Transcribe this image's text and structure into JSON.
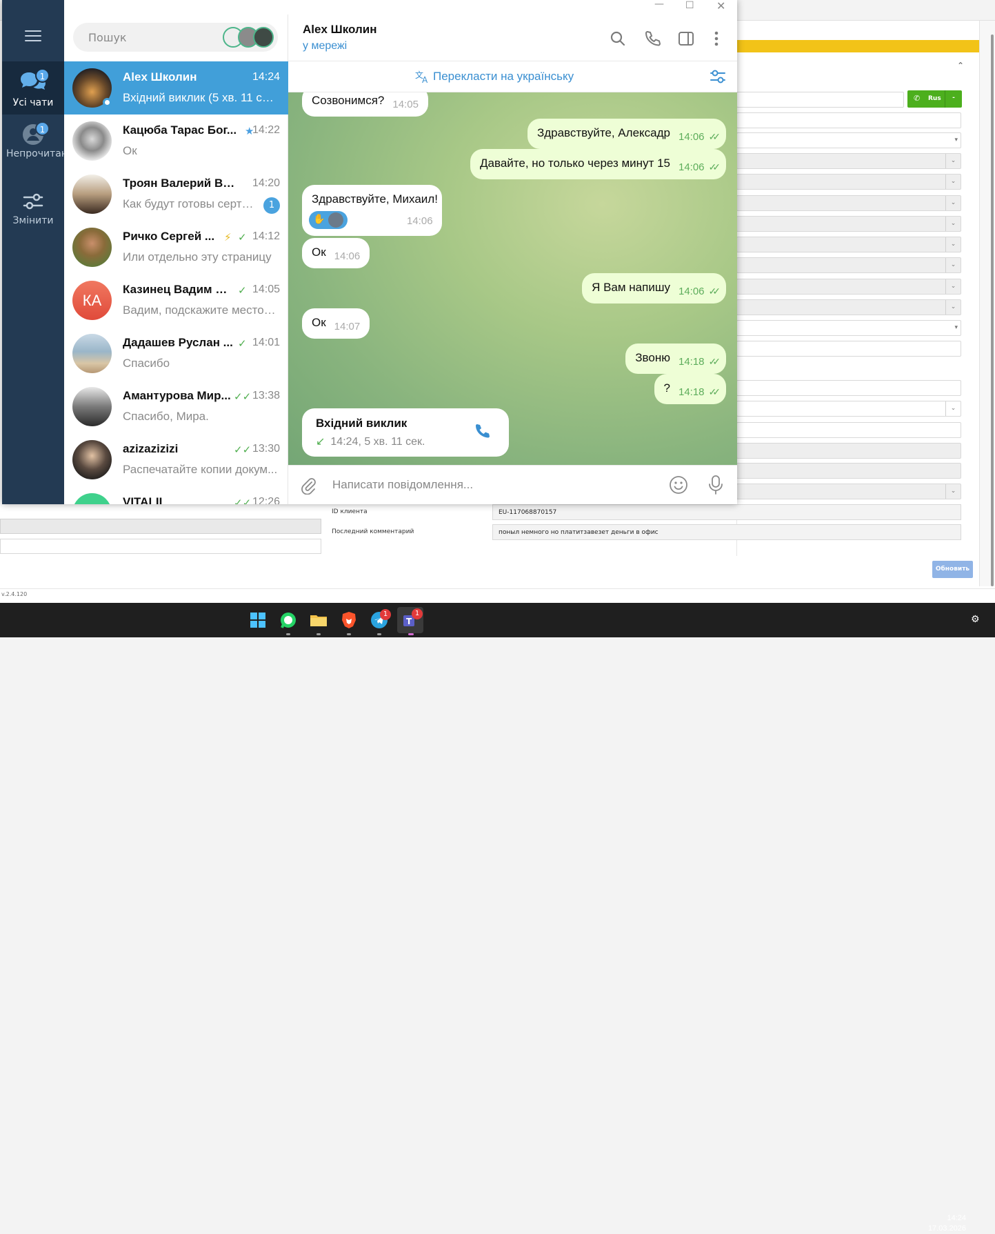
{
  "telegram": {
    "folders": [
      {
        "label": "Усі чати",
        "badge": "1"
      },
      {
        "label": "Непрочитано",
        "badge": "1"
      },
      {
        "label": "Змінити",
        "badge": ""
      }
    ],
    "search_placeholder": "Пошук",
    "chats": [
      {
        "name": "Alex Школин",
        "time": "14:24",
        "preview": "Вхідний виклик (5 хв. 11 сек.)",
        "status": "",
        "unread": ""
      },
      {
        "name": "Кацюба Тарас Бог...",
        "time": "14:22",
        "preview": "Ок",
        "status": "star",
        "unread": ""
      },
      {
        "name": "Троян Валерий Вале...",
        "time": "14:20",
        "preview": "Как будут готовы серти...",
        "status": "",
        "unread": "1"
      },
      {
        "name": "Ричко Сергей ...",
        "time": "14:12",
        "preview": "Или отдельно эту страницу",
        "status": "bolt+check",
        "unread": ""
      },
      {
        "name": "Казинец Вадим А...",
        "time": "14:05",
        "preview": "Вадим, подскажите место р...",
        "status": "check",
        "unread": "",
        "initials": "КА"
      },
      {
        "name": "Дадашев Руслан ...",
        "time": "14:01",
        "preview": "Спасибо",
        "status": "check",
        "unread": ""
      },
      {
        "name": "Амантурова Мир...",
        "time": "13:38",
        "preview": "Спасибо, Мира.",
        "status": "double-check",
        "unread": ""
      },
      {
        "name": "azizazizizi",
        "time": "13:30",
        "preview": "Распечатайте копии докум...",
        "status": "double-check",
        "unread": ""
      },
      {
        "name": "VITALII",
        "time": "12:26",
        "preview": "",
        "status": "double-check",
        "unread": ""
      }
    ],
    "header": {
      "title": "Alex Школин",
      "status": "у мережі"
    },
    "translate_label": "Перекласти на українську",
    "messages": [
      {
        "dir": "in",
        "text": "Созвонимся?",
        "time": "14:05"
      },
      {
        "dir": "out",
        "text": "Здравствуйте, Алексадр",
        "time": "14:06"
      },
      {
        "dir": "out",
        "text": "Давайте, но только через минут 15",
        "time": "14:06"
      },
      {
        "dir": "in",
        "text": "Здравствуйте, Михаил!",
        "time": "14:06"
      },
      {
        "dir": "in",
        "text": "Ок",
        "time": "14:06"
      },
      {
        "dir": "out",
        "text": "Я Вам напишу",
        "time": "14:06"
      },
      {
        "dir": "in",
        "text": "Ок",
        "time": "14:07"
      },
      {
        "dir": "out",
        "text": "Звоню",
        "time": "14:18"
      },
      {
        "dir": "out",
        "text": "?",
        "time": "14:18"
      }
    ],
    "call_card": {
      "title": "Вхідний виклик",
      "details": "14:24, 5 хв. 11 сек."
    },
    "compose_placeholder": "Написати повідомлення..."
  },
  "background_app": {
    "call_lang": "Rus",
    "client_id_label": "ID клиента",
    "client_id_value": "EU-117068870157",
    "last_comment_label": "Последний комментарий",
    "last_comment_value": "поныл немного но платитзавезет деньги в офис",
    "update_button": "Обновить",
    "version": "v.2.4.120"
  },
  "taskbar": {
    "time": "14:24",
    "date": "17.03.2026",
    "telegram_badge": "1",
    "teams_badge": "1"
  },
  "colors": {
    "telegram_accent": "#419fd9",
    "rail": "#233a53",
    "out_bubble": "#eefed6",
    "taskbar": "#1f1f1f"
  }
}
